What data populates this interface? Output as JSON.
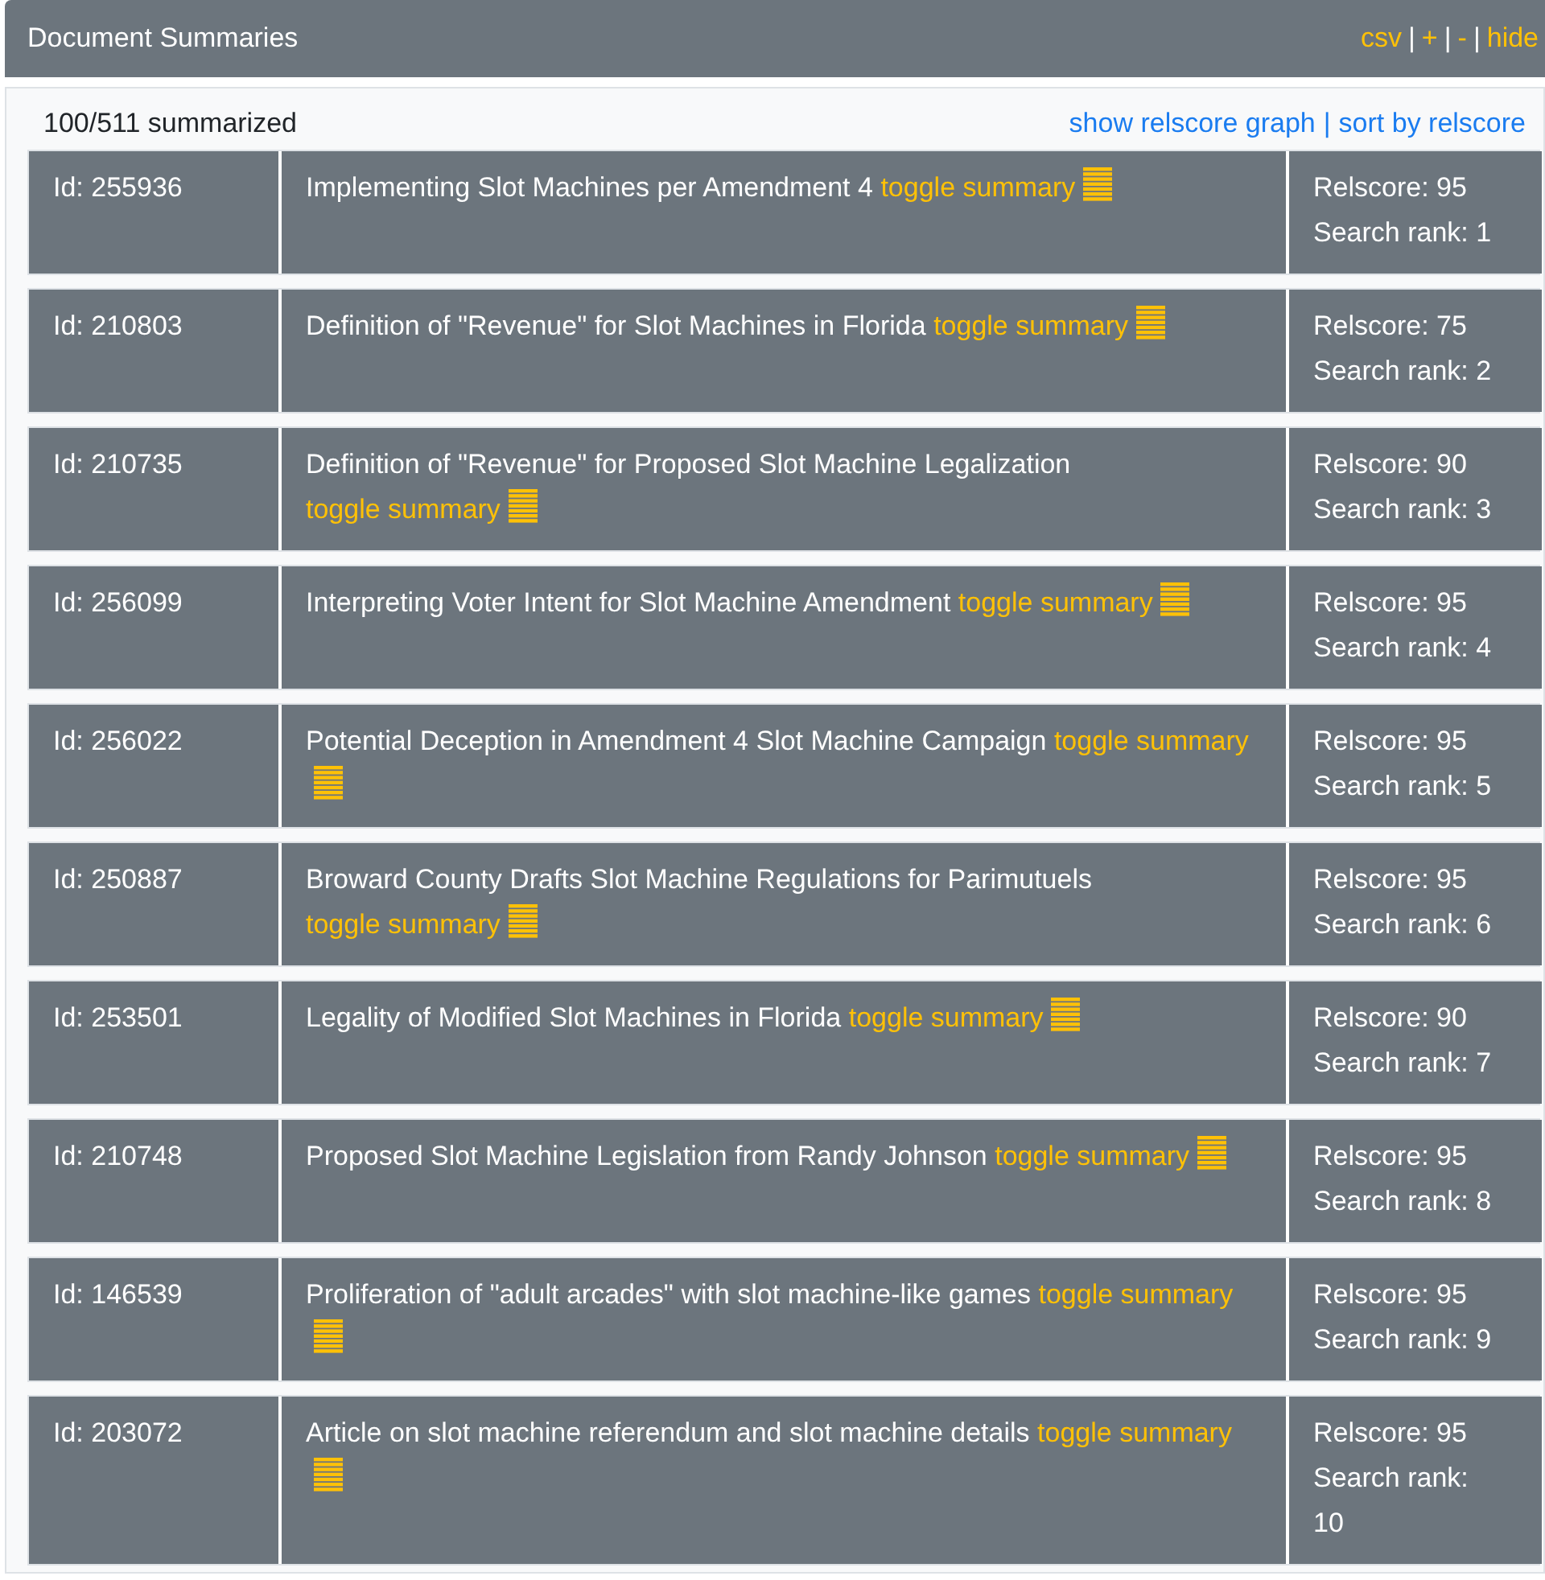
{
  "header": {
    "title": "Document Summaries",
    "links": [
      "csv",
      "+",
      "-",
      "hide"
    ],
    "separator": "|"
  },
  "summary": {
    "count": "100/511 summarized",
    "links": [
      "show relscore graph",
      "sort by relscore"
    ],
    "separator": "|"
  },
  "rows": [
    {
      "id": "Id: 255936",
      "title": "Implementing Slot Machines per Amendment 4",
      "toggle": "toggle summary",
      "relscore": "Relscore: 95",
      "rank": "Search rank: 1"
    },
    {
      "id": "Id: 210803",
      "title": "Definition of \"Revenue\" for Slot Machines in Florida",
      "toggle": "toggle summary",
      "relscore": "Relscore: 75",
      "rank": "Search rank: 2"
    },
    {
      "id": "Id: 210735",
      "title": "Definition of \"Revenue\" for Proposed Slot Machine Legalization",
      "toggle": "toggle summary",
      "relscore": "Relscore: 90",
      "rank": "Search rank: 3"
    },
    {
      "id": "Id: 256099",
      "title": "Interpreting Voter Intent for Slot Machine Amendment",
      "toggle": "toggle summary",
      "relscore": "Relscore: 95",
      "rank": "Search rank: 4"
    },
    {
      "id": "Id: 256022",
      "title": "Potential Deception in Amendment 4 Slot Machine Campaign",
      "toggle": "toggle summary",
      "relscore": "Relscore: 95",
      "rank": "Search rank: 5"
    },
    {
      "id": "Id: 250887",
      "title": "Broward County Drafts Slot Machine Regulations for Parimutuels",
      "toggle": "toggle summary",
      "relscore": "Relscore: 95",
      "rank": "Search rank: 6"
    },
    {
      "id": "Id: 253501",
      "title": "Legality of Modified Slot Machines in Florida",
      "toggle": "toggle summary",
      "relscore": "Relscore: 90",
      "rank": "Search rank: 7"
    },
    {
      "id": "Id: 210748",
      "title": "Proposed Slot Machine Legislation from Randy Johnson",
      "toggle": "toggle summary",
      "relscore": "Relscore: 95",
      "rank": "Search rank: 8"
    },
    {
      "id": "Id: 146539",
      "title": "Proliferation of \"adult arcades\" with slot machine-like games",
      "toggle": "toggle summary",
      "relscore": "Relscore: 95",
      "rank": "Search rank: 9"
    },
    {
      "id": "Id: 203072",
      "title": "Article on slot machine referendum and slot machine details",
      "toggle": "toggle summary",
      "relscore": "Relscore: 95",
      "rank": "Search rank: 10"
    }
  ]
}
